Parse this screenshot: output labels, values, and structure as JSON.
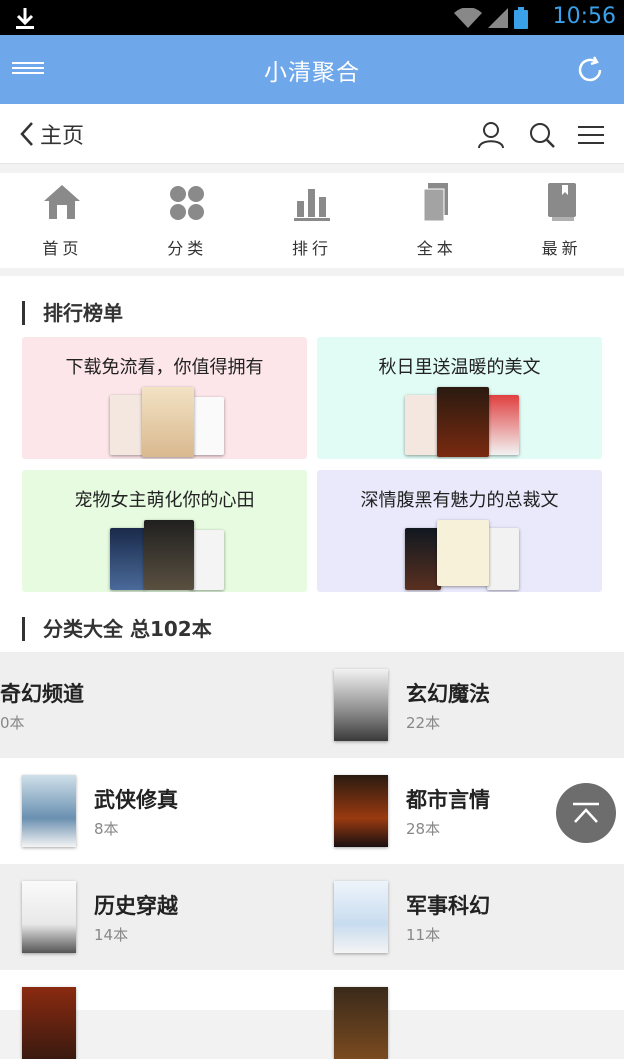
{
  "status": {
    "time": "10:56"
  },
  "app": {
    "title": "小清聚合"
  },
  "nav": {
    "back_label": "主页"
  },
  "quicknav": [
    {
      "label": "首页",
      "icon": "home-icon"
    },
    {
      "label": "分类",
      "icon": "category-icon"
    },
    {
      "label": "排行",
      "icon": "ranking-icon"
    },
    {
      "label": "全本",
      "icon": "books-icon"
    },
    {
      "label": "最新",
      "icon": "latest-book-icon"
    }
  ],
  "ranking": {
    "title": "排行榜单",
    "cards": [
      {
        "title": "下载免流看，你值得拥有",
        "bg": "#fde6ea"
      },
      {
        "title": "秋日里送温暖的美文",
        "bg": "#e1fbf5"
      },
      {
        "title": "宠物女主萌化你的心田",
        "bg": "#e6fbe0"
      },
      {
        "title": "深情腹黑有魅力的总裁文",
        "bg": "#e9e9fb"
      }
    ]
  },
  "categories": {
    "title": "分类大全 总102本",
    "items": [
      {
        "name": "奇幻频道",
        "count": "0本"
      },
      {
        "name": "玄幻魔法",
        "count": "22本"
      },
      {
        "name": "武侠修真",
        "count": "8本"
      },
      {
        "name": "都市言情",
        "count": "28本"
      },
      {
        "name": "历史穿越",
        "count": "14本"
      },
      {
        "name": "军事科幻",
        "count": "11本"
      }
    ]
  },
  "colors": {
    "app_bar": "#6ea7ea",
    "time": "#3aa0e8"
  }
}
